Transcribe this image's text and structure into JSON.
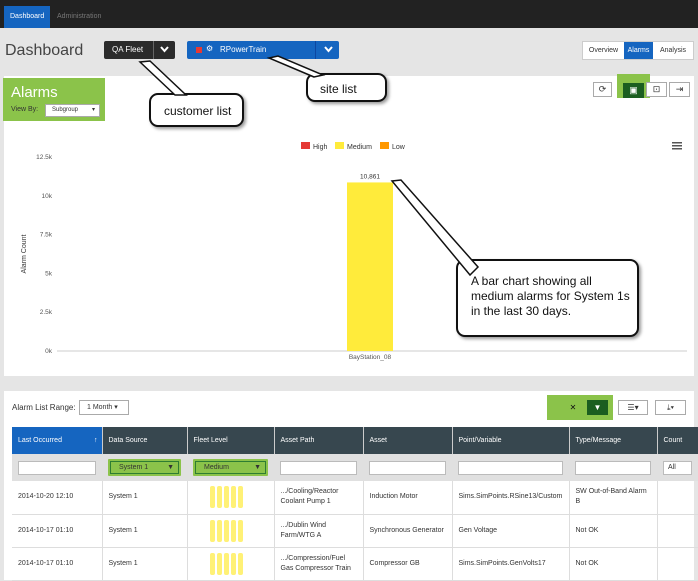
{
  "nav": {
    "tabs": [
      "Dashboard",
      "Administration"
    ]
  },
  "header": {
    "title": "Dashboard",
    "customer_select": "QA Fleet",
    "site_select": "RPowerTrain",
    "view_tabs": [
      "Overview",
      "Alarms",
      "Analysis"
    ],
    "active_view": "Alarms"
  },
  "alarms": {
    "title": "Alarms",
    "view_by_label": "View By:",
    "view_by_value": "Subgroup"
  },
  "callouts": {
    "customer": "customer list",
    "site": "site list",
    "chart": "A bar chart showing all medium alarms for System 1s in the last 30 days."
  },
  "colors": {
    "high": "#e53935",
    "medium": "#ffeb3b",
    "low": "#ff9800",
    "accent": "#1565c0",
    "highlight": "#8bc34a"
  },
  "chart_data": {
    "type": "bar",
    "categories": [
      "BayStation_08"
    ],
    "series": [
      {
        "name": "High",
        "values": [
          0
        ]
      },
      {
        "name": "Medium",
        "values": [
          10861
        ]
      },
      {
        "name": "Low",
        "values": [
          0
        ]
      }
    ],
    "data_labels": [
      "10,861"
    ],
    "ylabel": "Alarm Count",
    "yticks": [
      "0k",
      "2.5k",
      "5k",
      "7.5k",
      "10k",
      "12.5k"
    ],
    "ylim": [
      0,
      12500
    ],
    "grid": false,
    "legend": "top-center"
  },
  "alarm_list": {
    "range_label": "Alarm List Range:",
    "range_value": "1 Month",
    "columns": [
      "Last Occurred",
      "Data Source",
      "Fleet Level",
      "Asset Path",
      "Asset",
      "Point/Variable",
      "Type/Message",
      "Count"
    ],
    "filters": {
      "data_source": "System 1",
      "fleet_level": "Medium",
      "count": "All"
    },
    "rows": [
      {
        "last": "2014-10-20 12:10",
        "source": "System 1",
        "path": ".../Cooling/Reactor Coolant Pump 1",
        "asset": "Induction Motor",
        "point": "Sims.SimPoints.RSine13/Custom",
        "msg": "SW Out-of-Band Alarm B"
      },
      {
        "last": "2014-10-17 01:10",
        "source": "System 1",
        "path": ".../Dublin Wind Farm/WTG A",
        "asset": "Synchronous Generator",
        "point": "Gen Voltage",
        "msg": "Not OK"
      },
      {
        "last": "2014-10-17 01:10",
        "source": "System 1",
        "path": ".../Compression/Fuel Gas Compressor Train",
        "asset": "Compressor GB",
        "point": "Sims.SimPoints.GenVolts17",
        "msg": "Not OK"
      }
    ]
  }
}
